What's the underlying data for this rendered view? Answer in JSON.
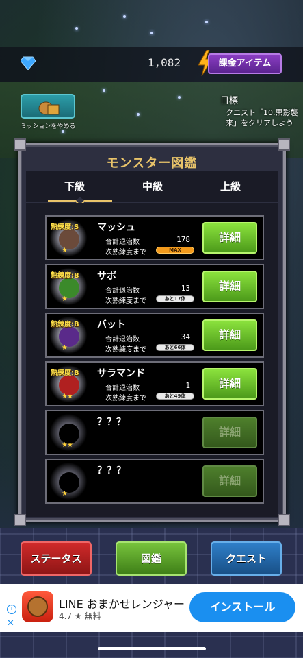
{
  "header": {
    "gem_count": "1,082",
    "shop_label": "課金アイテム",
    "icons": [
      "diamond-icon",
      "lightning-icon"
    ]
  },
  "mission": {
    "cancel_label": "ミッションをやめる",
    "icon": "treasure-bag-icon"
  },
  "goal": {
    "title": "目標",
    "text": "クエスト「10.黒影襲来」をクリアしよう"
  },
  "book": {
    "title": "モンスター図鑑",
    "tabs": [
      {
        "label": "下級",
        "selected": true
      },
      {
        "label": "中級",
        "selected": false
      },
      {
        "label": "上級",
        "selected": false
      }
    ],
    "stat_labels": {
      "kills": "合計退治数",
      "next": "次熟練度まで"
    },
    "detail_label": "詳細",
    "monsters": [
      {
        "mastery": "熟練度:S",
        "name": "マッシュ",
        "kills": "178",
        "next": "MAX",
        "stars": "★",
        "color": "#6b4a3a"
      },
      {
        "mastery": "熟練度:B",
        "name": "サボ",
        "kills": "13",
        "next": "あと17体",
        "stars": "★",
        "color": "#3b8a2a"
      },
      {
        "mastery": "熟練度:B",
        "name": "バット",
        "kills": "34",
        "next": "あと66体",
        "stars": "★",
        "color": "#5a2a8a"
      },
      {
        "mastery": "熟練度:B",
        "name": "サラマンド",
        "kills": "1",
        "next": "あと49体",
        "stars": "★★",
        "color": "#b02020"
      },
      {
        "mastery": "",
        "name": "？？？",
        "kills": "",
        "next": "",
        "stars": "★★",
        "color": "#000000"
      },
      {
        "mastery": "",
        "name": "？？？",
        "kills": "",
        "next": "",
        "stars": "★",
        "color": "#000000"
      }
    ]
  },
  "nav": {
    "status_label": "ステータス",
    "book_label": "図鑑",
    "quest_label": "クエスト"
  },
  "ad": {
    "title": "LINE おまかせレンジャー",
    "rating": "4.7 ★ 無料",
    "install_label": "インストール",
    "info_symbol": "i",
    "close_symbol": "✕"
  }
}
